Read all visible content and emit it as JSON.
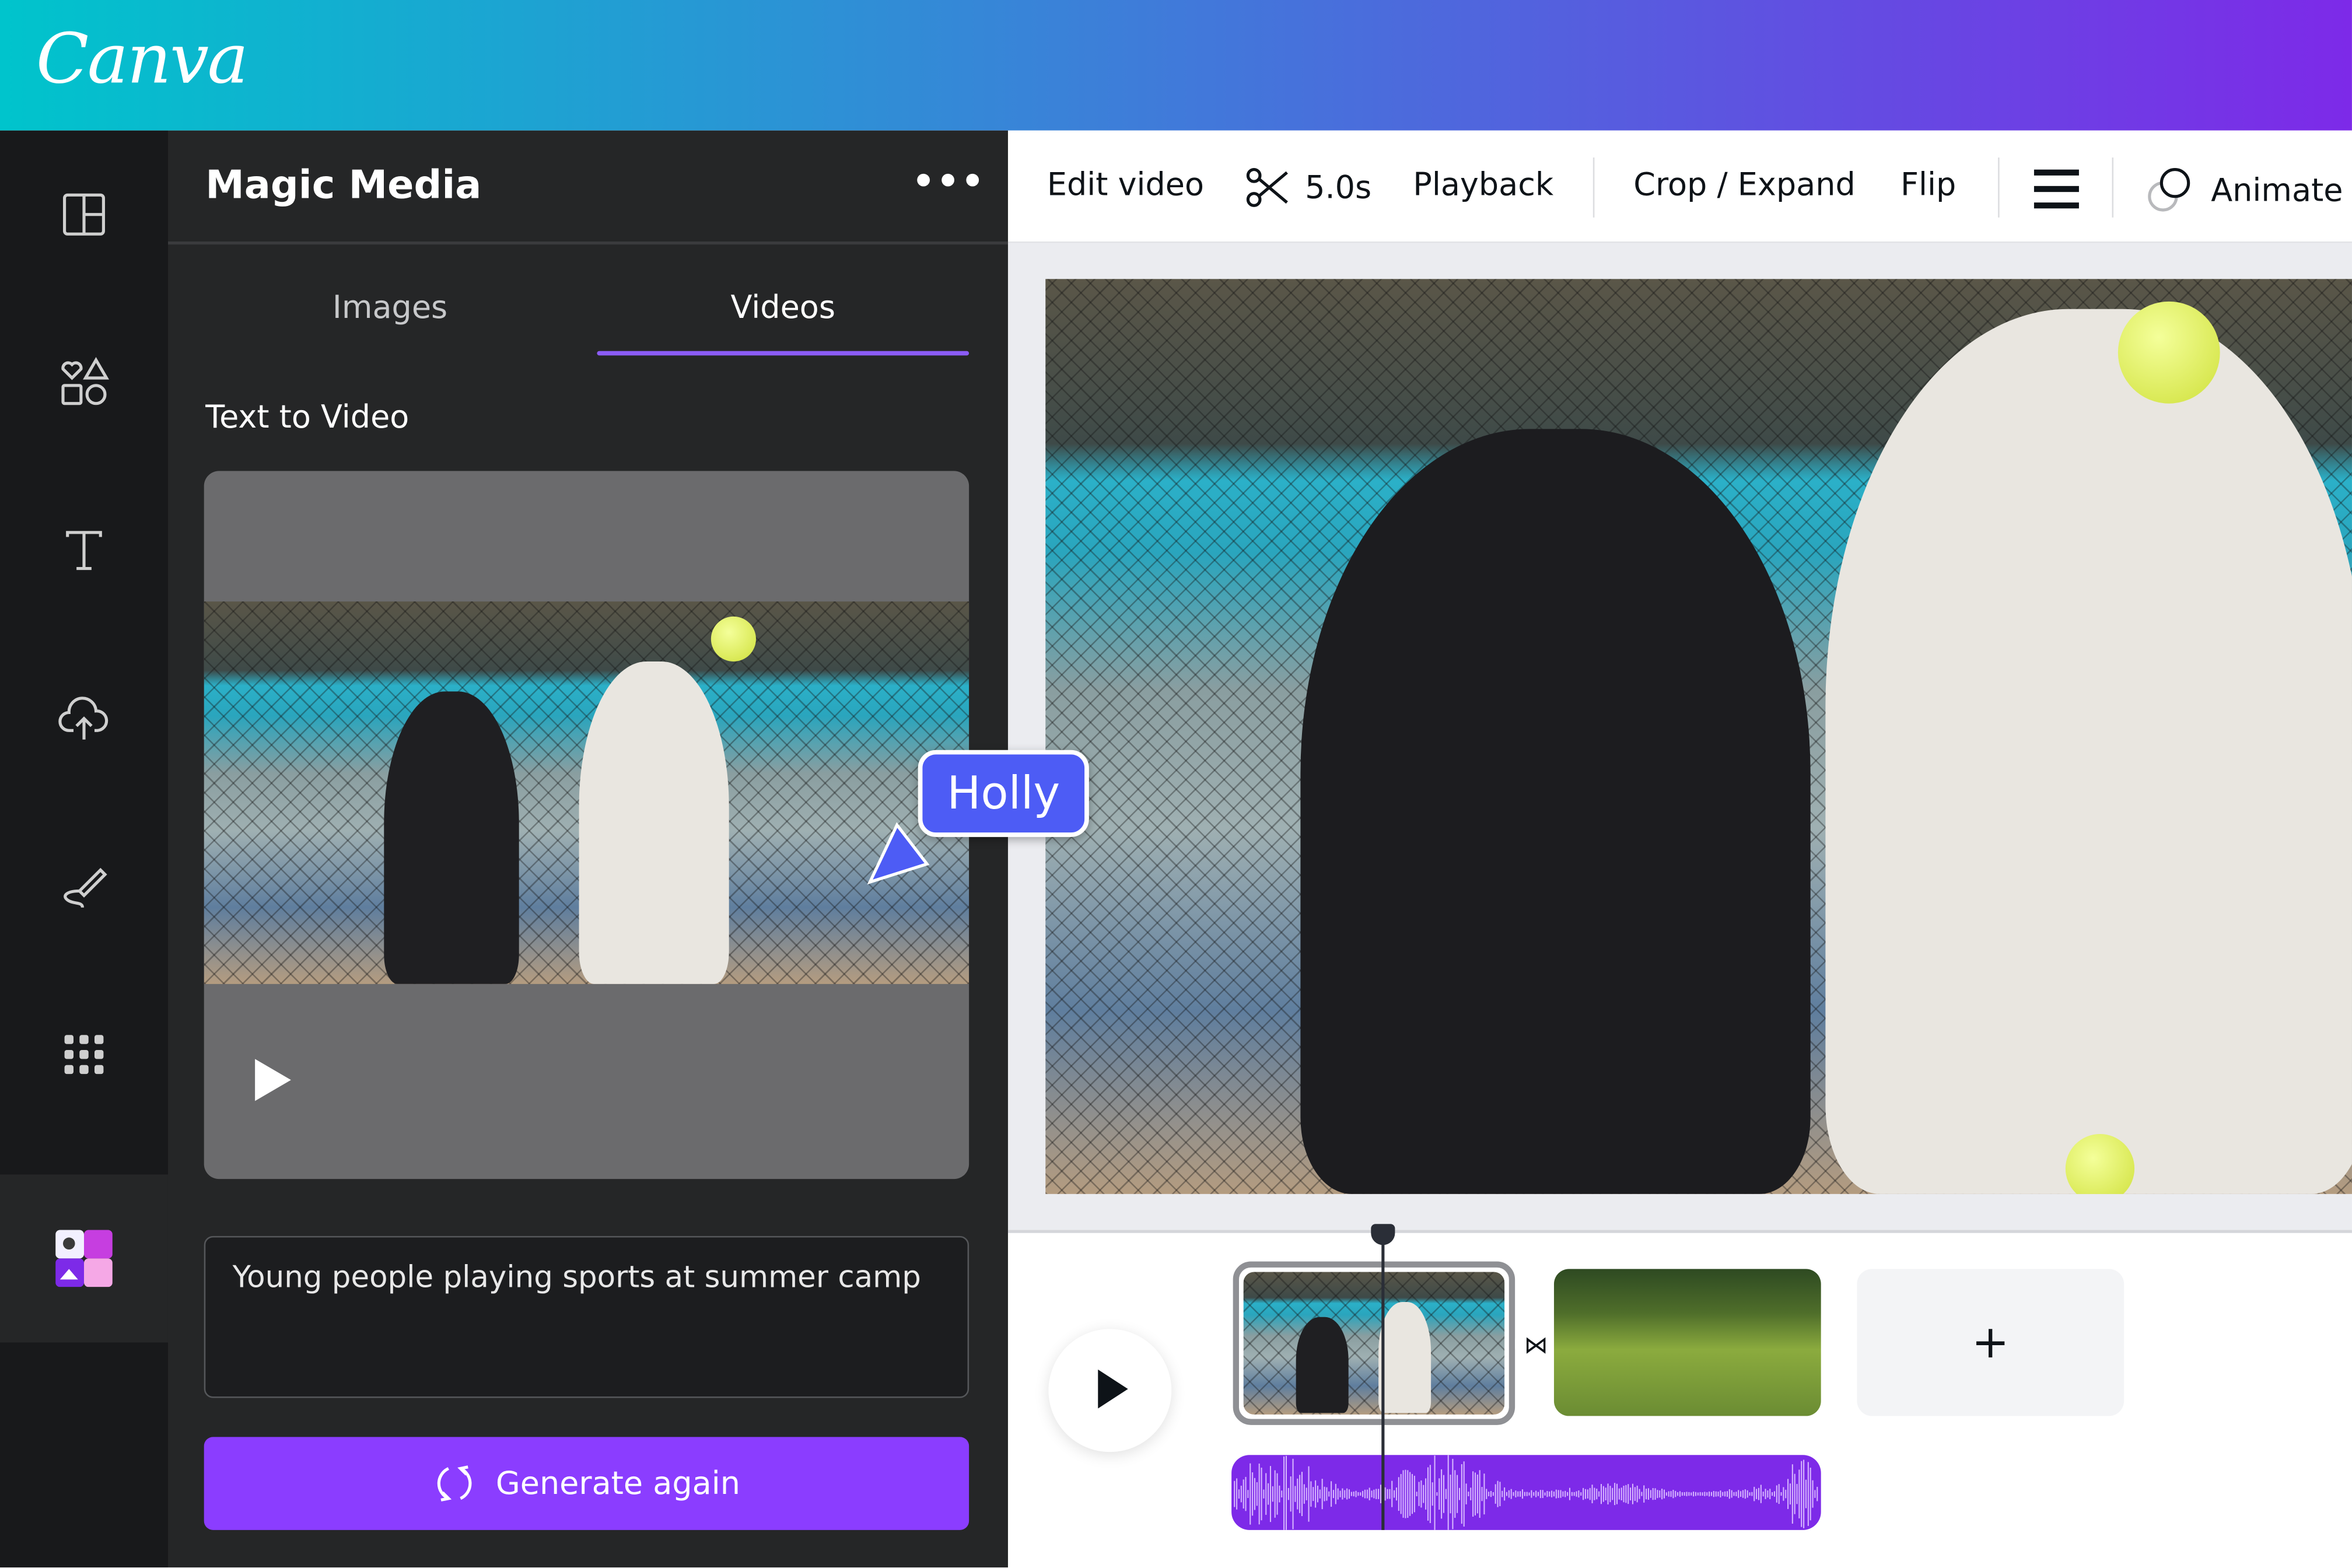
{
  "app": {
    "logo": "Canva",
    "brand_gradient": [
      "#00c4cc",
      "#7d2ae8"
    ],
    "accent": "#8b3dff"
  },
  "rail": {
    "items": [
      {
        "icon": "layout-icon",
        "label": "Design"
      },
      {
        "icon": "elements-icon",
        "label": "Elements"
      },
      {
        "icon": "text-icon",
        "label": "Text"
      },
      {
        "icon": "upload-cloud-icon",
        "label": "Uploads"
      },
      {
        "icon": "draw-icon",
        "label": "Draw"
      },
      {
        "icon": "apps-grid-icon",
        "label": "Apps"
      },
      {
        "icon": "magic-media-app-icon",
        "label": "Magic Media"
      }
    ]
  },
  "panel": {
    "title": "Magic Media",
    "more_icon": "more-horizontal-icon",
    "tabs": [
      {
        "label": "Images",
        "active": false
      },
      {
        "label": "Videos",
        "active": true
      }
    ],
    "section_title": "Text to Video",
    "prompt_value": "Young people playing sports at summer camp",
    "generate_button": "Generate again",
    "generate_icon": "refresh-icon"
  },
  "collaborator": {
    "name": "Holly",
    "color": "#4d5cf5"
  },
  "toolbar": {
    "edit_video": "Edit video",
    "duration": "5.0s",
    "playback": "Playback",
    "crop_expand": "Crop / Expand",
    "flip": "Flip",
    "animate": "Animate"
  },
  "timeline": {
    "add_label": "+",
    "clips": [
      "tennis-court-clip",
      "picnic-grass-clip"
    ],
    "audio_color": "#7d2ae8"
  }
}
